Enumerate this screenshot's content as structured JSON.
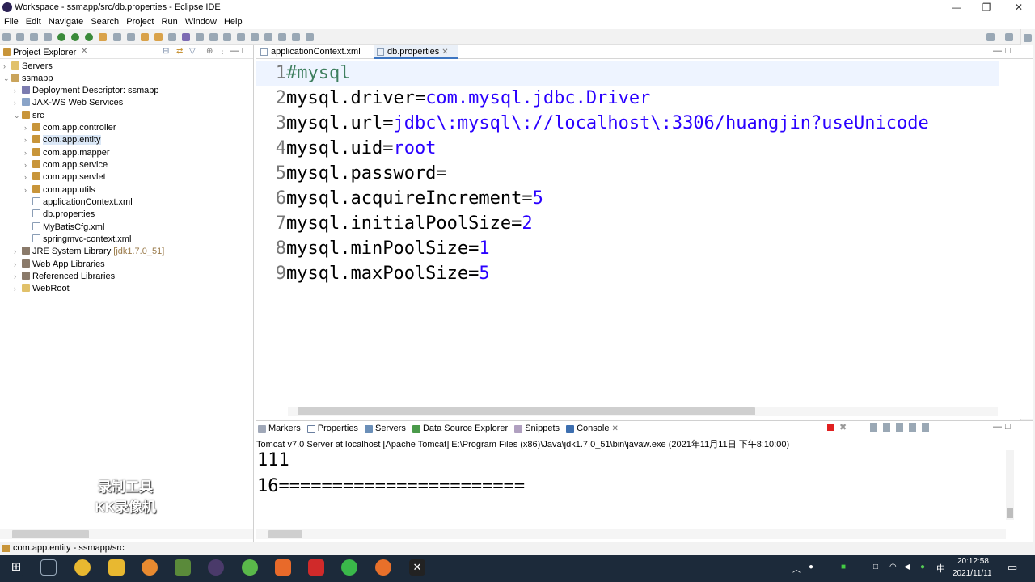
{
  "window": {
    "title": "Workspace - ssmapp/src/db.properties - Eclipse IDE",
    "minimize": "—",
    "maximize": "❐",
    "close": "✕"
  },
  "menu": [
    "File",
    "Edit",
    "Navigate",
    "Search",
    "Project",
    "Run",
    "Window",
    "Help"
  ],
  "left_panel": {
    "title": "Project Explorer",
    "tree": [
      {
        "label": "Servers",
        "icon": "folder-icon"
      },
      {
        "label": "ssmapp",
        "icon": "project-icon"
      },
      {
        "label": "Deployment Descriptor: ssmapp",
        "icon": "deployment-descriptor-icon"
      },
      {
        "label": "JAX-WS Web Services",
        "icon": "web-services-icon"
      },
      {
        "label": "src",
        "icon": "source-folder-icon"
      },
      {
        "label": "com.app.controller",
        "icon": "package-icon"
      },
      {
        "label": "com.app.entity",
        "icon": "package-icon"
      },
      {
        "label": "com.app.mapper",
        "icon": "package-icon"
      },
      {
        "label": "com.app.service",
        "icon": "package-icon"
      },
      {
        "label": "com.app.servlet",
        "icon": "package-icon"
      },
      {
        "label": "com.app.utils",
        "icon": "package-icon"
      },
      {
        "label": "applicationContext.xml",
        "icon": "xml-file-icon"
      },
      {
        "label": "db.properties",
        "icon": "properties-file-icon"
      },
      {
        "label": "MyBatisCfg.xml",
        "icon": "xml-file-icon"
      },
      {
        "label": "springmvc-context.xml",
        "icon": "xml-file-icon"
      },
      {
        "label": "JRE System Library",
        "suffix": "[jdk1.7.0_51]",
        "icon": "library-icon"
      },
      {
        "label": "Web App Libraries",
        "icon": "library-icon"
      },
      {
        "label": "Referenced Libraries",
        "icon": "library-icon"
      },
      {
        "label": "WebRoot",
        "icon": "folder-icon"
      }
    ],
    "watermark_line1": "录制工具",
    "watermark_line2": "KK录像机"
  },
  "editor": {
    "tabs": [
      {
        "label": "applicationContext.xml",
        "active": false
      },
      {
        "label": "db.properties",
        "active": true
      }
    ],
    "lines": [
      {
        "num": "1",
        "key": "#mysql",
        "val": ""
      },
      {
        "num": "2",
        "key": "mysql.driver=",
        "val": "com.mysql.jdbc.Driver"
      },
      {
        "num": "3",
        "key": "mysql.url=",
        "val": "jdbc\\:mysql\\://localhost\\:3306/huangjin?useUnicode"
      },
      {
        "num": "4",
        "key": "mysql.uid=",
        "val": "root"
      },
      {
        "num": "5",
        "key": "mysql.password=",
        "val": ""
      },
      {
        "num": "6",
        "key": "mysql.acquireIncrement=",
        "val": "5"
      },
      {
        "num": "7",
        "key": "mysql.initialPoolSize=",
        "val": "2"
      },
      {
        "num": "8",
        "key": "mysql.minPoolSize=",
        "val": "1"
      },
      {
        "num": "9",
        "key": "mysql.maxPoolSize=",
        "val": "5"
      }
    ]
  },
  "bottom_panel": {
    "tabs": [
      "Markers",
      "Properties",
      "Servers",
      "Data Source Explorer",
      "Snippets",
      "Console"
    ],
    "server_line": "Tomcat v7.0 Server at localhost [Apache Tomcat] E:\\Program Files (x86)\\Java\\jdk1.7.0_51\\bin\\javaw.exe  (2021年11月11日 下午8:10:00)",
    "output": [
      "111",
      "16======================="
    ]
  },
  "status": {
    "text": "com.app.entity - ssmapp/src"
  },
  "taskbar": {
    "time": "20:12:58",
    "date": "2021/11/11",
    "ime": "中"
  },
  "colors": {
    "keyword": "#000000",
    "value": "#2a00ff",
    "comment": "#3f7f5f",
    "selection": "#dbe8f7"
  }
}
